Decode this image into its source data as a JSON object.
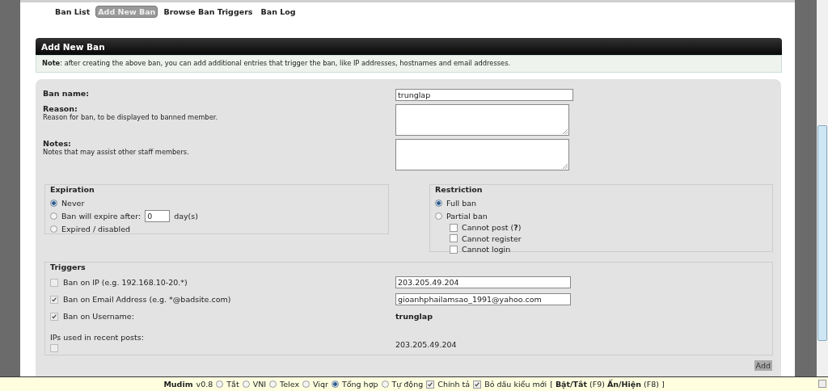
{
  "tabs": [
    {
      "label": "Ban List",
      "selected": false
    },
    {
      "label": "Add New Ban",
      "selected": true
    },
    {
      "label": "Browse Ban Triggers",
      "selected": false
    },
    {
      "label": "Ban Log",
      "selected": false
    }
  ],
  "header": {
    "title": "Add New Ban"
  },
  "note": "**Note**: after creating the above ban, you can add additional entries that trigger the ban, like IP addresses, hostnames and email addresses.",
  "fields": [
    {
      "kind": "input",
      "label": "Ban name:",
      "value": "trunglap"
    },
    {
      "kind": "textarea",
      "label": "Reason:",
      "description": "Reason for ban, to be displayed to banned member."
    },
    {
      "kind": "textarea",
      "label": "Notes:",
      "description": "Notes that may assist other staff members."
    }
  ],
  "expiration": {
    "legend": "Expiration",
    "options": [
      {
        "label": "Never",
        "selected": true
      },
      {
        "label": "Ban will expire after:",
        "selected": false,
        "value": "0",
        "unit": "day(s)"
      },
      {
        "label": "Expired / disabled",
        "selected": false
      }
    ]
  },
  "restriction": {
    "legend": "Restriction",
    "options": [
      {
        "label": "Full ban",
        "selected": true
      },
      {
        "label": "Partial ban",
        "selected": false
      }
    ],
    "sub_options": [
      {
        "label": "Cannot post (**?**)",
        "checked": false
      },
      {
        "label": "Cannot register",
        "checked": false
      },
      {
        "label": "Cannot login",
        "checked": false
      }
    ]
  },
  "triggers": {
    "legend": "Triggers",
    "rows": [
      {
        "kind": "input",
        "label": "Ban on IP (e.g. 192.168.10-20.*)",
        "checked": false,
        "value": "203.205.49.204"
      },
      {
        "kind": "input",
        "label": "Ban on Email Address (e.g. *@badsite.com)",
        "checked": true,
        "value": "gioanhphailamsao_1991@yahoo.com"
      },
      {
        "kind": "text",
        "label": "Ban on Username:",
        "checked": true,
        "value": "trunglap"
      },
      {
        "kind": "ips",
        "label": "IPs used in recent posts:",
        "checked": false,
        "value": "203.205.49.204"
      }
    ]
  },
  "add_button": "Add",
  "mudim": {
    "name": "Mudim",
    "version": "v0.8",
    "modes": [
      {
        "label": "Tắt",
        "selected": false
      },
      {
        "label": "VNI",
        "selected": false
      },
      {
        "label": "Telex",
        "selected": false
      },
      {
        "label": "Viqr",
        "selected": false
      },
      {
        "label": "Tổng hợp",
        "selected": true
      },
      {
        "label": "Tự động",
        "selected": false
      }
    ],
    "options": [
      {
        "label": "Chính tả",
        "checked": true
      },
      {
        "label": "Bỏ dấu kiểu mới",
        "checked": true
      }
    ],
    "hotkeys": "[ **Bật/Tắt** (F9) **Ấn/Hiện** (F8) ]"
  }
}
